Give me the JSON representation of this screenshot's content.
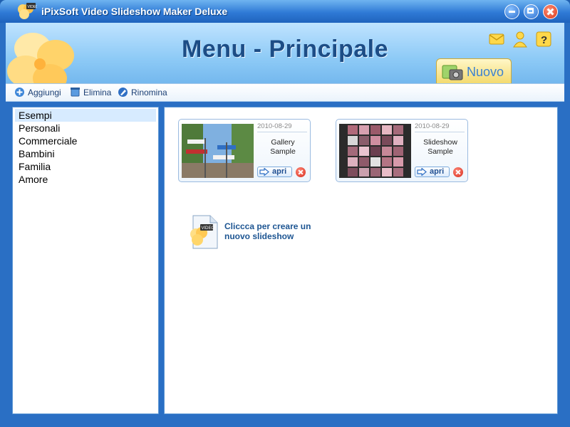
{
  "window": {
    "title": "iPixSoft Video Slideshow Maker Deluxe"
  },
  "header": {
    "title": "Menu - Principale",
    "new_tab_label": "Nuovo"
  },
  "toolbar": {
    "add_label": "Aggiungi",
    "delete_label": "Elimina",
    "rename_label": "Rinomina"
  },
  "sidebar": {
    "categories": [
      {
        "label": "Esempi",
        "selected": true
      },
      {
        "label": "Personali"
      },
      {
        "label": "Commerciale"
      },
      {
        "label": "Bambini"
      },
      {
        "label": "Familia"
      },
      {
        "label": "Amore"
      }
    ]
  },
  "projects": [
    {
      "date": "2010-08-29",
      "name_line1": "Gallery",
      "name_line2": "Sample",
      "open_label": "apri"
    },
    {
      "date": "2010-08-29",
      "name_line1": "Slideshow",
      "name_line2": "Sample",
      "open_label": "apri"
    }
  ],
  "create": {
    "line1": "Cliccca per creare un",
    "line2": "nuovo slideshow"
  },
  "icons": {
    "logo": "clover-video-icon",
    "message": "message-icon",
    "user": "user-icon",
    "help": "help-icon",
    "new": "new-project-icon"
  },
  "colors": {
    "titlebar": "#2f7ad6",
    "header_title": "#1d4d86",
    "selection": "#d7ebff",
    "accent": "#1d5592"
  }
}
